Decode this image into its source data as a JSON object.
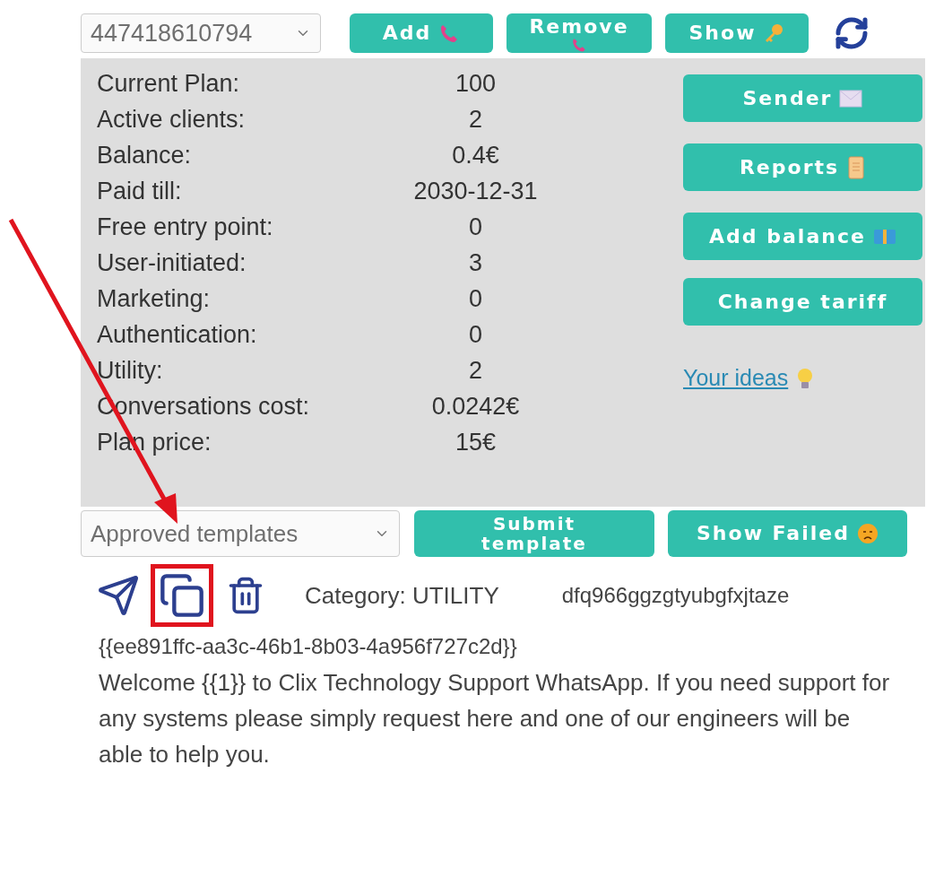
{
  "phone_select": {
    "value": "447418610794"
  },
  "top_buttons": [
    {
      "label": "Add",
      "kind": "phone"
    },
    {
      "label": "Remove",
      "kind": "phone"
    },
    {
      "label": "Show",
      "kind": "key"
    }
  ],
  "stats": [
    {
      "label": "Current Plan:",
      "value": "100"
    },
    {
      "label": "Active clients:",
      "value": "2"
    },
    {
      "label": "Balance:",
      "value": "0.4€"
    },
    {
      "label": "Paid till:",
      "value": "2030-12-31"
    },
    {
      "label": "Free entry point:",
      "value": "0"
    },
    {
      "label": "User-initiated:",
      "value": "3"
    },
    {
      "label": "Marketing:",
      "value": "0"
    },
    {
      "label": "Authentication:",
      "value": "0"
    },
    {
      "label": "Utility:",
      "value": "2"
    },
    {
      "label": "Conversations cost:",
      "value": "0.0242€"
    },
    {
      "label": "Plan price:",
      "value": "15€"
    }
  ],
  "side_buttons": [
    {
      "label": "Sender",
      "kind": "envelope"
    },
    {
      "label": "Reports",
      "kind": "scroll"
    },
    {
      "label": "Add balance",
      "kind": "money"
    },
    {
      "label": "Change tariff",
      "kind": "none"
    }
  ],
  "ideas_link": {
    "label": "Your ideas",
    "kind": "bulb"
  },
  "template_select": {
    "value": "Approved templates"
  },
  "template_buttons": [
    {
      "label": "Submit template",
      "kind": "none"
    },
    {
      "label": "Show Failed",
      "kind": "sad-face"
    }
  ],
  "template": {
    "category": "Category: UTILITY",
    "name": "dfq966ggzgtyubgfxjtaze",
    "id": "{{ee891ffc-aa3c-46b1-8b03-4a956f727c2d}}",
    "body": "Welcome {{1}} to Clix Technology Support WhatsApp. If you need support for any systems please simply request here and one of our engineers will be able to help you."
  }
}
